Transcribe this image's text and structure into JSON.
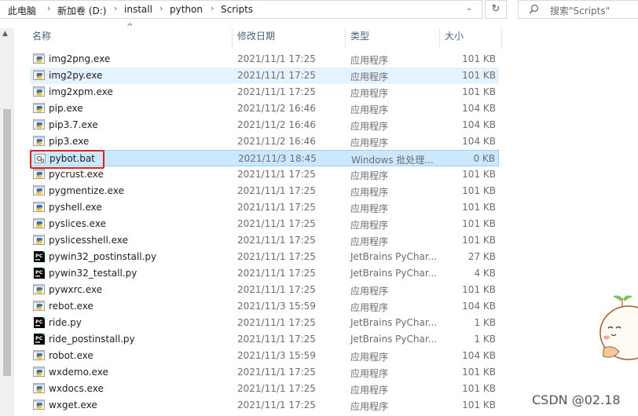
{
  "address": {
    "crumbs": [
      "此电脑",
      "新加卷 (D:)",
      "install",
      "python",
      "Scripts"
    ]
  },
  "search": {
    "placeholder": "搜索\"Scripts\""
  },
  "columns": {
    "name": "名称",
    "date": "修改日期",
    "type": "类型",
    "size": "大小"
  },
  "files": [
    {
      "name": "img2png.exe",
      "date": "2021/11/1 17:25",
      "type": "应用程序",
      "size": "101 KB",
      "icon": "python-exe-icon"
    },
    {
      "name": "img2py.exe",
      "date": "2021/11/1 17:25",
      "type": "应用程序",
      "size": "101 KB",
      "icon": "python-exe-icon",
      "state": "hover"
    },
    {
      "name": "img2xpm.exe",
      "date": "2021/11/1 17:25",
      "type": "应用程序",
      "size": "101 KB",
      "icon": "python-exe-icon"
    },
    {
      "name": "pip.exe",
      "date": "2021/11/2 16:46",
      "type": "应用程序",
      "size": "104 KB",
      "icon": "python-exe-icon"
    },
    {
      "name": "pip3.7.exe",
      "date": "2021/11/2 16:46",
      "type": "应用程序",
      "size": "104 KB",
      "icon": "python-exe-icon"
    },
    {
      "name": "pip3.exe",
      "date": "2021/11/2 16:46",
      "type": "应用程序",
      "size": "104 KB",
      "icon": "python-exe-icon"
    },
    {
      "name": "pybot.bat",
      "date": "2021/11/3 18:45",
      "type": "Windows 批处理...",
      "size": "0 KB",
      "icon": "batch-file-icon",
      "state": "selected"
    },
    {
      "name": "pycrust.exe",
      "date": "2021/11/1 17:25",
      "type": "应用程序",
      "size": "101 KB",
      "icon": "python-exe-icon"
    },
    {
      "name": "pygmentize.exe",
      "date": "2021/11/1 17:25",
      "type": "应用程序",
      "size": "101 KB",
      "icon": "python-exe-icon"
    },
    {
      "name": "pyshell.exe",
      "date": "2021/11/1 17:25",
      "type": "应用程序",
      "size": "101 KB",
      "icon": "python-exe-icon"
    },
    {
      "name": "pyslices.exe",
      "date": "2021/11/1 17:25",
      "type": "应用程序",
      "size": "101 KB",
      "icon": "python-exe-icon"
    },
    {
      "name": "pyslicesshell.exe",
      "date": "2021/11/1 17:25",
      "type": "应用程序",
      "size": "101 KB",
      "icon": "python-exe-icon"
    },
    {
      "name": "pywin32_postinstall.py",
      "date": "2021/11/1 17:25",
      "type": "JetBrains PyChar...",
      "size": "27 KB",
      "icon": "pycharm-file-icon"
    },
    {
      "name": "pywin32_testall.py",
      "date": "2021/11/1 17:25",
      "type": "JetBrains PyChar...",
      "size": "4 KB",
      "icon": "pycharm-file-icon"
    },
    {
      "name": "pywxrc.exe",
      "date": "2021/11/1 17:25",
      "type": "应用程序",
      "size": "101 KB",
      "icon": "python-exe-icon"
    },
    {
      "name": "rebot.exe",
      "date": "2021/11/3 15:59",
      "type": "应用程序",
      "size": "104 KB",
      "icon": "python-exe-icon"
    },
    {
      "name": "ride.py",
      "date": "2021/11/1 17:25",
      "type": "JetBrains PyChar...",
      "size": "1 KB",
      "icon": "pycharm-file-icon"
    },
    {
      "name": "ride_postinstall.py",
      "date": "2021/11/1 17:25",
      "type": "JetBrains PyChar...",
      "size": "1 KB",
      "icon": "pycharm-file-icon"
    },
    {
      "name": "robot.exe",
      "date": "2021/11/3 15:59",
      "type": "应用程序",
      "size": "104 KB",
      "icon": "python-exe-icon"
    },
    {
      "name": "wxdemo.exe",
      "date": "2021/11/1 17:25",
      "type": "应用程序",
      "size": "101 KB",
      "icon": "python-exe-icon"
    },
    {
      "name": "wxdocs.exe",
      "date": "2021/11/1 17:25",
      "type": "应用程序",
      "size": "101 KB",
      "icon": "python-exe-icon"
    },
    {
      "name": "wxget.exe",
      "date": "2021/11/1 17:25",
      "type": "应用程序",
      "size": "101 KB",
      "icon": "python-exe-icon"
    }
  ],
  "watermark": "CSDN @02.18",
  "colors": {
    "selected_bg": "#cce8ff",
    "hover_bg": "#e5f3ff",
    "highlight_box": "#e02020",
    "header_text": "#4c607a"
  }
}
